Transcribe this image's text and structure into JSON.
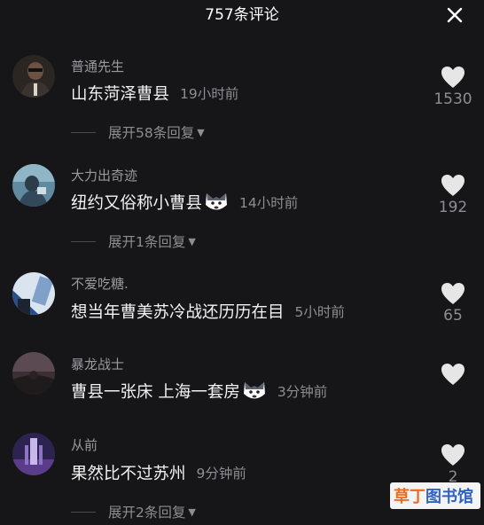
{
  "header": {
    "title": "757条评论"
  },
  "colors": {
    "background": "#161618",
    "secondary_text": "#8e8e92",
    "heart": "#e6e6e6"
  },
  "comments": [
    {
      "user": "普通先生",
      "text": "山东菏泽曹县",
      "time": "19小时前",
      "likes": "1530",
      "replies": "展开58条回复",
      "emoji": ""
    },
    {
      "user": "大力出奇迹",
      "text": "纽约又俗称小曹县",
      "time": "14小时前",
      "likes": "192",
      "replies": "展开1条回复",
      "emoji": "wolf-emoji"
    },
    {
      "user": "不爱吃糖.",
      "text": "想当年曹美苏冷战还历历在目",
      "time": "5小时前",
      "likes": "65",
      "replies": "",
      "emoji": ""
    },
    {
      "user": "暴龙战士",
      "text": "曹县一张床 上海一套房",
      "time": "3分钟前",
      "likes": "",
      "replies": "",
      "emoji": "wolf-emoji"
    },
    {
      "user": "从前",
      "text": "果然比不过苏州",
      "time": "9分钟前",
      "likes": "2",
      "replies": "展开2条回复",
      "emoji": ""
    }
  ],
  "watermark": {
    "part1": "草丁",
    "part2": "图书馆"
  }
}
